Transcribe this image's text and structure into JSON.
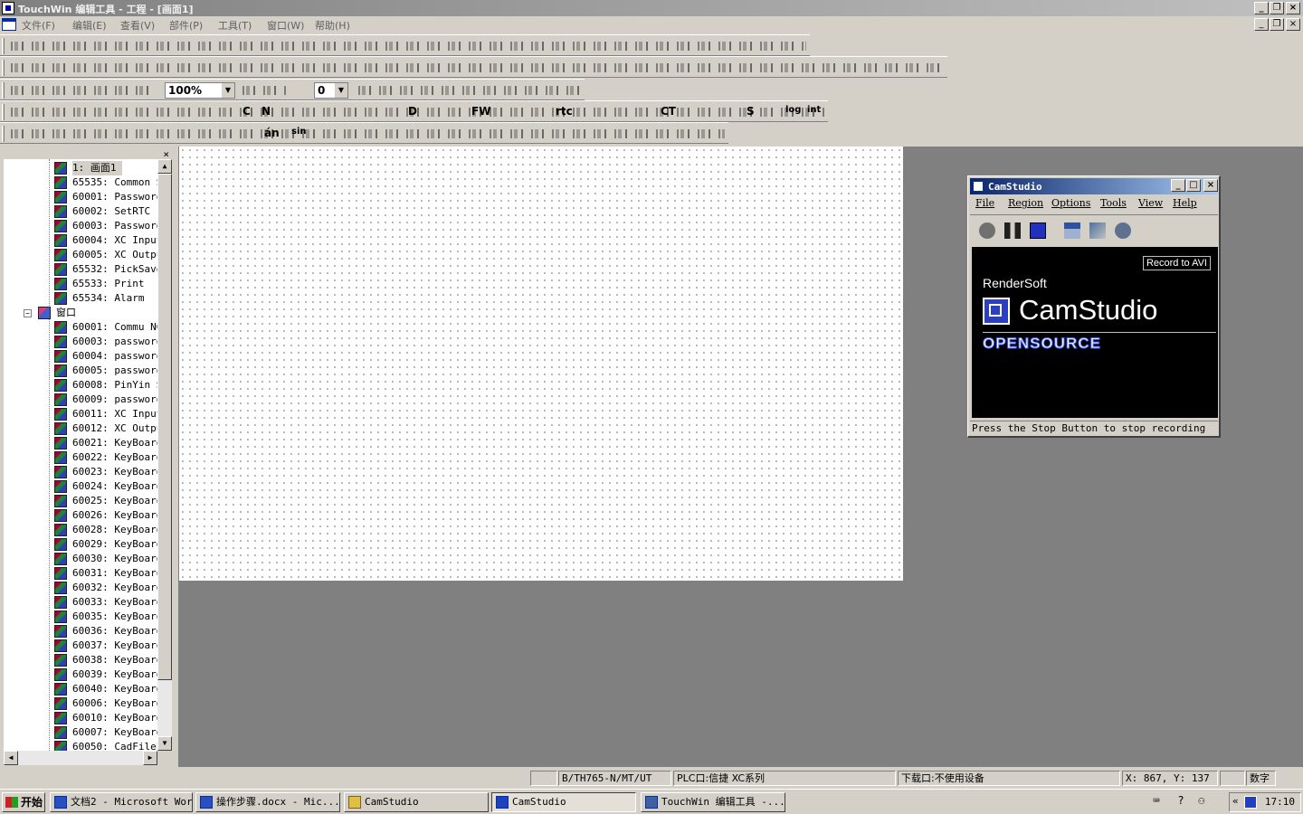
{
  "window": {
    "title": "TouchWin 编辑工具 - 工程 - [画面1]"
  },
  "menubar": {
    "items": [
      "文件(F)",
      "编辑(E)",
      "查看(V)",
      "部件(P)",
      "工具(T)",
      "窗口(W)",
      "帮助(H)"
    ]
  },
  "toolbar": {
    "zoom": "100%",
    "layer_value": "0",
    "row5_text": [
      "C",
      "N",
      "D",
      "FW",
      "rtc",
      "CT",
      "S",
      "log",
      "int",
      "sin",
      "án"
    ]
  },
  "tree": {
    "screen_items": [
      "1: 画面1",
      "65535: Common S",
      "60001: Password",
      "60002: SetRTC",
      "60003: Password",
      "60004: XC Input",
      "60005: XC Outpu",
      "65532: PickSave",
      "65533: Print",
      "65534: Alarm"
    ],
    "window_folder": "窗口",
    "window_items": [
      "60001: Commu NG",
      "60003: password",
      "60004: password",
      "60005: password",
      "60008: PinYin S",
      "60009: password",
      "60011: XC Input",
      "60012: XC Outpu",
      "60021: KeyBoard",
      "60022: KeyBoard",
      "60023: KeyBoard",
      "60024: KeyBoard",
      "60025: KeyBoard",
      "60026: KeyBoard",
      "60028: KeyBoard",
      "60029: KeyBoard",
      "60030: KeyBoard",
      "60031: KeyBoard",
      "60032: KeyBoard",
      "60033: KeyBoard",
      "60035: KeyBoard",
      "60036: KeyBoard",
      "60037: KeyBoard",
      "60038: KeyBoard",
      "60039: KeyBoard",
      "60040: KeyBoard",
      "60006: KeyBoard",
      "60010: KeyBoard",
      "60007: KeyBoard",
      "60050: CadFileL"
    ]
  },
  "camstudio": {
    "title": "CamStudio",
    "menu": [
      "File",
      "Region",
      "Options",
      "Tools",
      "View",
      "Help"
    ],
    "record_badge": "Record to AVI",
    "company": "RenderSoft",
    "product": "CamStudio",
    "tagline": "OPENSOURCE",
    "status": "Press the Stop Button to stop recording"
  },
  "statusbar": {
    "model": "B/TH765-N/MT/UT",
    "plc": "PLC口:信捷 XC系列",
    "download": "下载口:不使用设备",
    "coords": "X: 867, Y: 137",
    "mode": "数字"
  },
  "taskbar": {
    "start": "开始",
    "buttons": [
      "文档2 - Microsoft Word",
      "操作步骤.docx - Mic...",
      "CamStudio",
      "CamStudio",
      "TouchWin 编辑工具 -..."
    ],
    "clock": "17:10"
  }
}
